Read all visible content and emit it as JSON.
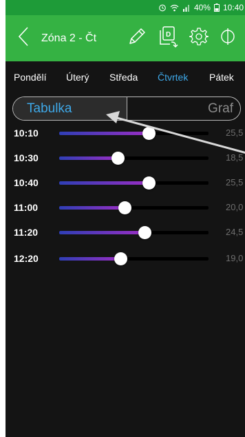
{
  "status_bar": {
    "battery": "40%",
    "time": "10:40",
    "icons": [
      "alarm-icon",
      "wifi-icon",
      "signal-icon",
      "battery-icon"
    ]
  },
  "app_bar": {
    "title": "Zóna 2 - Čt",
    "icons": [
      "back-chevron-icon",
      "pencil-icon",
      "copy-day-icon",
      "gear-icon",
      "power-icon"
    ]
  },
  "days": [
    {
      "label": "Pondělí",
      "active": false
    },
    {
      "label": "Úterý",
      "active": false
    },
    {
      "label": "Středa",
      "active": false
    },
    {
      "label": "Čtvrtek",
      "active": true
    },
    {
      "label": "Pátek",
      "active": false
    }
  ],
  "view_toggle": {
    "table_label": "Tabulka",
    "graph_label": "Graf",
    "selected": "Tabulka"
  },
  "schedule": [
    {
      "time": "10:10",
      "temp": "25,5",
      "level": 0.6
    },
    {
      "time": "10:30",
      "temp": "18,5",
      "level": 0.39
    },
    {
      "time": "10:40",
      "temp": "25,5",
      "level": 0.6
    },
    {
      "time": "11:00",
      "temp": "20,0",
      "level": 0.44
    },
    {
      "time": "11:20",
      "temp": "24,5",
      "level": 0.57
    },
    {
      "time": "12:20",
      "temp": "19,0",
      "level": 0.41
    }
  ],
  "colors": {
    "status_bar": "#1e9b38",
    "app_bar": "#35b243",
    "background": "#141414",
    "accent": "#3ea8e8",
    "slider_start": "#2f3fb6",
    "slider_end": "#9a2ec4"
  }
}
